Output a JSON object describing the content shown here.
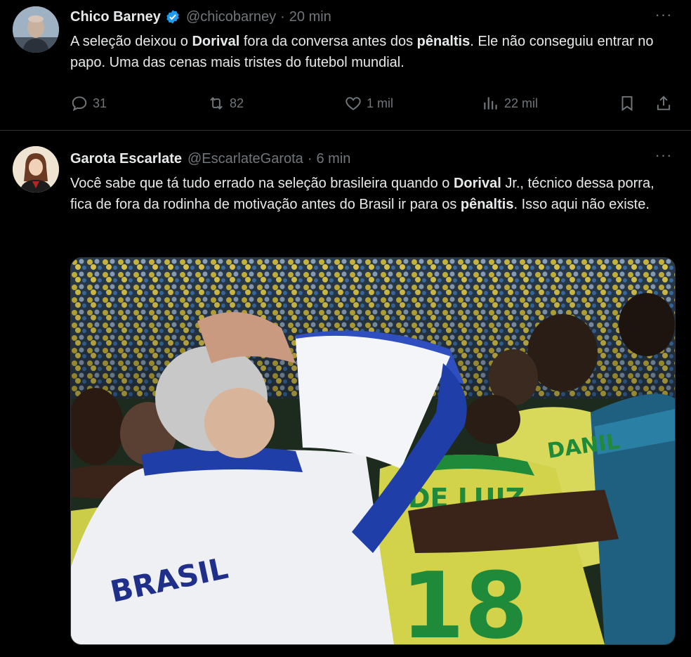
{
  "tweets": [
    {
      "author": {
        "name": "Chico Barney",
        "handle": "@chicobarney",
        "verified": true
      },
      "time": "20 min",
      "text": [
        "A seleção deixou o ",
        "Dorival",
        " fora da conversa antes dos ",
        "pênaltis",
        ". Ele não conseguiu entrar no papo. Uma das cenas mais tristes do futebol mundial."
      ],
      "actions": {
        "replies": "31",
        "reposts": "82",
        "likes": "1 mil",
        "views": "22 mil"
      }
    },
    {
      "author": {
        "name": "Garota Escarlate",
        "handle": "@EscarlateGarota"
      },
      "time": "6 min",
      "text": [
        "Você sabe que tá tudo errado na seleção brasileira quando o ",
        "Dorival",
        " Jr., técnico dessa porra, fica de fora da rodinha de motivação antes do Brasil ir para os ",
        "pênaltis",
        ". Isso aqui não existe."
      ],
      "media": {
        "jacket_text": "BRASIL",
        "shirt_name_left": "DE LUIZ",
        "shirt_name_right": "DANIL",
        "shirt_number": "18"
      }
    }
  ],
  "icons": [
    "verified-badge-icon",
    "more-icon",
    "reply-icon",
    "repost-icon",
    "like-icon",
    "views-icon",
    "bookmark-icon",
    "share-icon"
  ],
  "colors": {
    "background": "#000000",
    "text": "#e7e9ea",
    "muted": "#71767b",
    "verified": "#1d9bf0",
    "border": "#2f3336"
  }
}
